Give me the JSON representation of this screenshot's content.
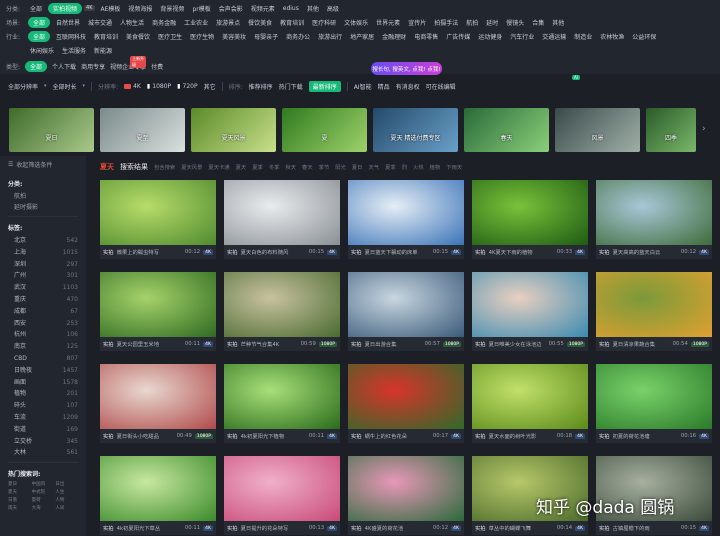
{
  "filters": {
    "row1": {
      "label": "分类:",
      "options": [
        "全部",
        "实拍视频",
        "AE模板",
        "视频海报",
        "背景视频",
        "pr模板",
        "会声会影",
        "视频元素",
        "edius",
        "其他",
        "高级"
      ],
      "active": "实拍视频",
      "badge": "4K"
    },
    "row2": {
      "label": "场景:",
      "options": [
        "全部",
        "自然世界",
        "城市交通",
        "人物生活",
        "商务金融",
        "工业农业",
        "旅游景点",
        "餐饮美食",
        "教育培训",
        "医疗科研",
        "文体娱乐",
        "世界元素",
        "宣传片",
        "拍摄手法",
        "航拍",
        "延时",
        "慢镜头",
        "合集",
        "其他"
      ],
      "active": "全部"
    },
    "row3": {
      "label": "行业:",
      "options": [
        "全部",
        "互联网科技",
        "教育培训",
        "美食餐饮",
        "医疗卫生",
        "医疗生物",
        "美容美妆",
        "母婴亲子",
        "商务办公",
        "旅游出行",
        "地产家居",
        "金融理财",
        "电商零售",
        "广告传媒",
        "运动健身",
        "汽车行业",
        "交通运输",
        "制造业",
        "农林牧渔",
        "公益环保"
      ],
      "active": "全部"
    },
    "row4": {
      "options": [
        "休闲娱乐",
        "生活服务",
        "新能源"
      ]
    }
  },
  "type_row": {
    "label": "类型:",
    "options": [
      "全部",
      "个人下载",
      "商用专享",
      "视频企业专享",
      "付费"
    ],
    "active": "全部",
    "new_tag": "上新升级"
  },
  "search_pill": "搜长句, 搜英文, 点我! 点我!",
  "sort_row": {
    "items": [
      "全部分辨率",
      "全部时长",
      "分辨率:",
      "4K",
      "1080P",
      "720P",
      "其它",
      "排序:",
      "推荐排序",
      "热门下载",
      "最新排序",
      "AI智能",
      "精品",
      "有消息权",
      "可在线编辑"
    ],
    "active": "最新排序",
    "ai_badge": "AI"
  },
  "categories": [
    {
      "label": "夏日",
      "color1": "#3e6b2a",
      "color2": "#a9c98a"
    },
    {
      "label": "夏至",
      "color1": "#7a8a8a",
      "color2": "#d9e0dd"
    },
    {
      "label": "夏天风景",
      "color1": "#5a8a2a",
      "color2": "#c9e08a"
    },
    {
      "label": "夏",
      "color1": "#2f7a1f",
      "color2": "#9ed26a"
    },
    {
      "label": "夏天 精选付费专区",
      "color1": "#244a6a",
      "color2": "#6aa0c9"
    },
    {
      "label": "春天",
      "color1": "#2a6a3a",
      "color2": "#8ad07a"
    },
    {
      "label": "风景",
      "color1": "#3a4a4a",
      "color2": "#a0b0a8"
    },
    {
      "label": "四季",
      "color1": "#2a5a2a",
      "color2": "#7ab86a"
    }
  ],
  "sidebar": {
    "collapse": "收起筛选条件",
    "class_title": "分类:",
    "class_items": [
      "航拍",
      "延时摄影"
    ],
    "region_title": "标签:",
    "regions": [
      {
        "name": "北京",
        "count": "542"
      },
      {
        "name": "上海",
        "count": "1015"
      },
      {
        "name": "深圳",
        "count": "297"
      },
      {
        "name": "广州",
        "count": "301"
      },
      {
        "name": "武汉",
        "count": "1103"
      },
      {
        "name": "重庆",
        "count": "470"
      },
      {
        "name": "成都",
        "count": "67"
      },
      {
        "name": "西安",
        "count": "253"
      },
      {
        "name": "杭州",
        "count": "106"
      },
      {
        "name": "南京",
        "count": "125"
      },
      {
        "name": "CBD",
        "count": "807"
      },
      {
        "name": "日晚夜",
        "count": "1457"
      },
      {
        "name": "画面",
        "count": "1578"
      },
      {
        "name": "植物",
        "count": "201"
      },
      {
        "name": "碎头",
        "count": "107"
      },
      {
        "name": "车流",
        "count": "1209"
      },
      {
        "name": "街道",
        "count": "169"
      },
      {
        "name": "立交桥",
        "count": "345"
      },
      {
        "name": "大林",
        "count": "561"
      }
    ],
    "hot_title": "热门搜索词:",
    "hot_terms": [
      "夏日",
      "中国风",
      "日出",
      "夏天",
      "中式院",
      "人生",
      "日落",
      "夏荷",
      "人物",
      "雨天",
      "大海",
      "人间"
    ]
  },
  "results": {
    "keyword": "夏天",
    "title": "搜索结果",
    "related": [
      "包含搜索",
      "夏天风景",
      "夏天卡通",
      "夏天",
      "夏季",
      "冬季",
      "秋天",
      "春天",
      "季节",
      "阳光",
      "夏日",
      "天气",
      "夏季",
      "烈",
      "火热",
      "植物",
      "下雨天"
    ]
  },
  "tiles": [
    {
      "kind": "实拍",
      "name": "微果上的瓢虫特写",
      "dur": "00:12",
      "res": "4K",
      "c1": "#4f8a2f",
      "c2": "#b8dc6a"
    },
    {
      "kind": "实拍",
      "name": "夏天白色的布料随风",
      "dur": "00:15",
      "res": "4K",
      "c1": "#8a8f94",
      "c2": "#e8ecef"
    },
    {
      "kind": "实拍",
      "name": "夏日蓝天下飘动的床单",
      "dur": "00:15",
      "res": "4K",
      "c1": "#3a73b8",
      "c2": "#e6eef5"
    },
    {
      "kind": "实拍",
      "name": "4K夏天下雨的植物",
      "dur": "00:33",
      "res": "4K",
      "c1": "#1e5a14",
      "c2": "#7ac23a"
    },
    {
      "kind": "实拍",
      "name": "夏天高高的蓝天白云",
      "dur": "00:12",
      "res": "4K",
      "c1": "#3f6b3a",
      "c2": "#a8c8d8"
    },
    {
      "kind": "实拍",
      "name": "夏天公园里玉米地",
      "dur": "00:11",
      "res": "4K",
      "c1": "#2f6a22",
      "c2": "#a6d26a"
    },
    {
      "kind": "实拍",
      "name": "芒种节气合集4K",
      "dur": "00:59",
      "res": "1080P",
      "c1": "#4a6a30",
      "c2": "#c8c2a0"
    },
    {
      "kind": "实拍",
      "name": "夏日出游合集",
      "dur": "00:57",
      "res": "1080P",
      "c1": "#3a5a7a",
      "c2": "#c8d6e0"
    },
    {
      "kind": "实拍",
      "name": "夏日唯美少女在泳池边",
      "dur": "00:55",
      "res": "1080P",
      "c1": "#3a8ab0",
      "c2": "#e8d0c0"
    },
    {
      "kind": "实拍",
      "name": "夏日清凉果蔬合集",
      "dur": "00:54",
      "res": "1080P",
      "c1": "#e0a030",
      "c2": "#7a9a3a"
    },
    {
      "kind": "实拍",
      "name": "夏日街头小吃甜品",
      "dur": "00:49",
      "res": "1080P",
      "c1": "#b04a4a",
      "c2": "#e8d8d0"
    },
    {
      "kind": "实拍",
      "name": "4k初夏阳光下植物",
      "dur": "00:11",
      "res": "4K",
      "c1": "#2a6a1a",
      "c2": "#a8e07a"
    },
    {
      "kind": "实拍",
      "name": "蜗牛上的红色花朵",
      "dur": "00:17",
      "res": "4K",
      "c1": "#2e6a2a",
      "c2": "#d8342a"
    },
    {
      "kind": "实拍",
      "name": "夏天水面的树叶光影",
      "dur": "00:18",
      "res": "4K",
      "c1": "#5a8a1a",
      "c2": "#c2e06a"
    },
    {
      "kind": "实拍",
      "name": "初夏的荷花池塘",
      "dur": "00:16",
      "res": "4K",
      "c1": "#2a7a2a",
      "c2": "#7ad26a"
    },
    {
      "kind": "实拍",
      "name": "4k初夏阳光下草丛",
      "dur": "00:11",
      "res": "4K",
      "c1": "#3a8a2a",
      "c2": "#c8e8a0"
    },
    {
      "kind": "实拍",
      "name": "夏日提升的花朵特写",
      "dur": "00:13",
      "res": "4K",
      "c1": "#c84a7a",
      "c2": "#f0b0c8"
    },
    {
      "kind": "实拍",
      "name": "4K盛夏的荷花池",
      "dur": "00:12",
      "res": "4K",
      "c1": "#2a6a3a",
      "c2": "#e898b8"
    },
    {
      "kind": "实拍",
      "name": "草丛中的蝴蝶飞舞",
      "dur": "00:14",
      "res": "4K",
      "c1": "#4a6a2a",
      "c2": "#b8c86a"
    },
    {
      "kind": "实拍",
      "name": "古镇屋檐下的雨",
      "dur": "00:15",
      "res": "4K",
      "c1": "#3a4a3a",
      "c2": "#a8b0a0"
    }
  ],
  "watermark": "知乎 @dada 圆锅"
}
